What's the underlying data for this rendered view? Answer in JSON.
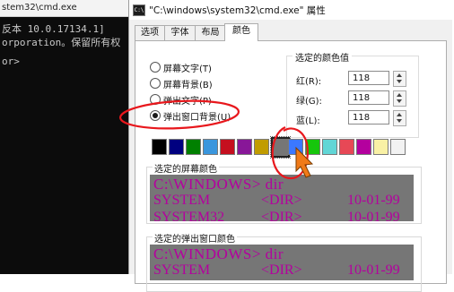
{
  "background_console": {
    "title": "stem32\\cmd.exe",
    "lines": [
      "反本 10.0.17134.1]",
      "orporation。保留所有权",
      "or>"
    ]
  },
  "dialog": {
    "title": "\"C:\\windows\\system32\\cmd.exe\" 属性",
    "icon_label": "C:\\",
    "tabs": [
      "选项",
      "字体",
      "布局",
      "颜色"
    ],
    "active_tab": "颜色",
    "radio_options": [
      {
        "label": "屏幕文字(T)",
        "checked": false
      },
      {
        "label": "屏幕背景(B)",
        "checked": false
      },
      {
        "label": "弹出文字(P)",
        "checked": false
      },
      {
        "label": "弹出窗口背景(U)",
        "checked": true
      }
    ],
    "selected_color_values": {
      "title": "选定的颜色值",
      "rows": [
        {
          "label": "红(R):",
          "value": "118"
        },
        {
          "label": "绿(G):",
          "value": "118"
        },
        {
          "label": "蓝(L):",
          "value": "118"
        }
      ]
    },
    "palette": [
      {
        "color": "#000000",
        "name": "black"
      },
      {
        "color": "#000080",
        "name": "dark-blue"
      },
      {
        "color": "#008000",
        "name": "dark-green"
      },
      {
        "color": "#3a96dd",
        "name": "teal"
      },
      {
        "color": "#c50f1f",
        "name": "dark-red"
      },
      {
        "color": "#881798",
        "name": "dark-magenta"
      },
      {
        "color": "#c19c00",
        "name": "dark-yellow"
      },
      {
        "color": "#767676",
        "name": "gray",
        "selected": true
      },
      {
        "color": "#3b78ff",
        "name": "blue"
      },
      {
        "color": "#16c60c",
        "name": "green"
      },
      {
        "color": "#61d6d6",
        "name": "cyan"
      },
      {
        "color": "#e74856",
        "name": "red"
      },
      {
        "color": "#b4009e",
        "name": "magenta"
      },
      {
        "color": "#f9f1a5",
        "name": "light-yellow"
      },
      {
        "color": "#f2f2f2",
        "name": "white"
      }
    ],
    "screen_preview": {
      "title": "选定的屏幕颜色",
      "lines": [
        "C:\\WINDOWS> dir"
      ],
      "rows": [
        [
          "SYSTEM",
          "<DIR>",
          "10-01-99"
        ],
        [
          "SYSTEM32",
          "<DIR>",
          "10-01-99"
        ]
      ]
    },
    "popup_preview": {
      "title": "选定的弹出窗口颜色",
      "lines": [
        "C:\\WINDOWS> dir"
      ],
      "rows": [
        [
          "SYSTEM",
          "<DIR>",
          "10-01-99"
        ]
      ]
    }
  },
  "colors": {
    "preview_bg": "#767676",
    "preview_fg": "#b4009e",
    "annotation_red": "#e8171c",
    "cursor_orange": "#f07a18"
  }
}
